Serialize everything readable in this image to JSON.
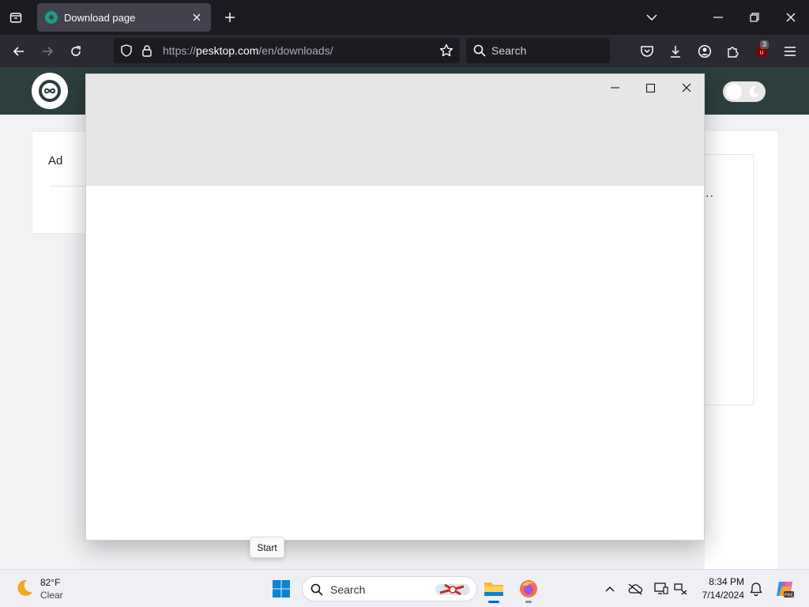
{
  "browser": {
    "tab": {
      "title": "Download page"
    },
    "url": {
      "scheme": "https://",
      "host": "pesktop.com",
      "path": "/en/downloads/"
    },
    "search_placeholder": "Search",
    "extension_badge": "3"
  },
  "page": {
    "ad_label": "Ad",
    "ellipsis": "..",
    "colors": {
      "header": "#2c3e3e",
      "brand": "#1f9c86"
    }
  },
  "popup": {
    "state": "blank window"
  },
  "tooltip": {
    "text": "Start"
  },
  "taskbar": {
    "weather": {
      "temp": "82°F",
      "condition": "Clear"
    },
    "search_placeholder": "Search",
    "time": "8:34 PM",
    "date": "7/14/2024"
  }
}
